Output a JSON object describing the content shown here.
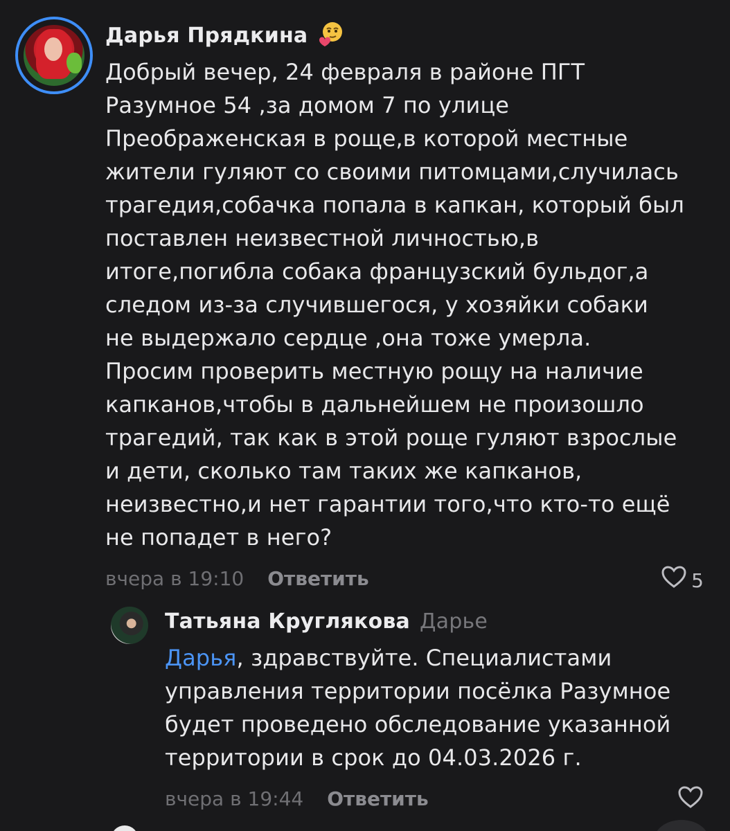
{
  "comments": [
    {
      "author": "Дарья Прядкина",
      "avatar_icon": "avatar-photo",
      "emoji_icon": "smirking-face-with-heart-emoji",
      "body": "Добрый вечер, 24 февраля в районе ПГТ\nРазумное 54 ,за домом 7 по улице\nПреображенская в роще,в которой местные\nжители гуляют со своими питомцами,случилась\nтрагедия,собачка попала в капкан, который был\nпоставлен  неизвестной личностью,в\nитоге,погибла собака французский бульдог,а\nследом из-за случившегося, у хозяйки собаки\nне выдержало сердце ,она тоже умерла.\nПросим проверить местную рощу на наличие\nкапканов,чтобы в дальнейшем не произошло\nтрагедий, так как в этой роще гуляют взрослые\nи дети, сколько там таких же капканов,\nнеизвестно,и нет гарантии того,что кто-то ещё\nне попадет в него?",
      "time": "вчера в 19:10",
      "reply_label": "Ответить",
      "likes": "5"
    },
    {
      "author": "Татьяна Круглякова",
      "reply_to": "Дарье",
      "mention": "Дарья",
      "body": ", здравствуйте. Специалистами\nуправления территории посёлка Разумное\nбудет проведено обследование указанной\nтерритории в срок до 04.03.2026 г.",
      "time": "вчера в 19:44",
      "reply_label": "Ответить"
    }
  ],
  "colors": {
    "background": "#19191b",
    "accent": "#3e8ef7",
    "mention": "#4b94f5",
    "muted": "#6f6f73"
  }
}
